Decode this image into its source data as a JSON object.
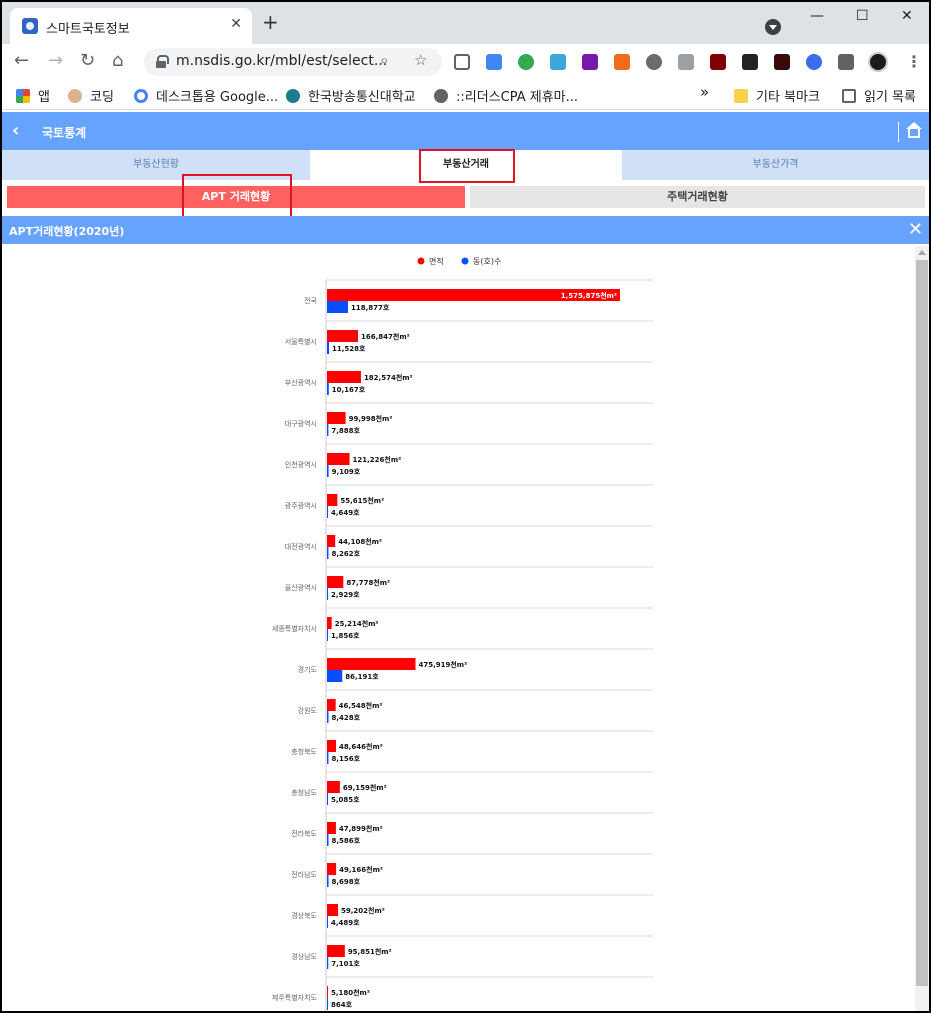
{
  "browser": {
    "tab_title": "스마트국토정보",
    "new_tab": "+",
    "url": "m.nsdis.go.kr/mbl/est/select...",
    "bookmarks": [
      {
        "label": "앱",
        "icon": "apps-grid-icon"
      },
      {
        "label": "코딩",
        "icon": "dog-icon"
      },
      {
        "label": "데스크톱용 Google...",
        "icon": "google-icon"
      },
      {
        "label": "한국방송통신대학교",
        "icon": "knou-icon"
      },
      {
        "label": "::리더스CPA 제휴마...",
        "icon": "globe-icon"
      }
    ],
    "more_bookmarks": "»",
    "other_bookmarks": "기타 북마크",
    "reading_list": "읽기 목록"
  },
  "app": {
    "title": "국토통계",
    "main_tabs": [
      "부동산현황",
      "부동산거래",
      "부동산가격"
    ],
    "active_main_tab": "부동산거래",
    "sub_tabs": [
      "APT 거래현황",
      "주택거래현황"
    ],
    "active_sub_tab": "APT 거래현황",
    "section_title": "APT거래현황(2020년)",
    "colors": {
      "header": "#66a3ff",
      "area": "#ff0000",
      "count": "#0a4fff",
      "active_sub": "#ff6161",
      "highlight": "#e2121e"
    }
  },
  "chart_data": {
    "type": "bar",
    "orientation": "horizontal",
    "legend_position": "top-center",
    "series": [
      {
        "name": "면적",
        "unit": "천m²",
        "color": "#ff0000",
        "values": [
          1575875,
          166847,
          182574,
          99998,
          121226,
          55615,
          44108,
          87778,
          25214,
          475919,
          46548,
          48646,
          69159,
          47899,
          49166,
          59202,
          95851,
          5180
        ]
      },
      {
        "name": "동(호)수",
        "unit": "호",
        "color": "#0a4fff",
        "values": [
          118877,
          11528,
          10167,
          7888,
          9109,
          4649,
          8262,
          2929,
          1856,
          86191,
          8428,
          8156,
          5085,
          8586,
          8698,
          4489,
          7101,
          864
        ]
      }
    ],
    "categories": [
      "전국",
      "서울특별시",
      "부산광역시",
      "대구광역시",
      "인천광역시",
      "광주광역시",
      "대전광역시",
      "울산광역시",
      "세종특별자치시",
      "경기도",
      "강원도",
      "충청북도",
      "충청남도",
      "전라북도",
      "전라남도",
      "경상북도",
      "경상남도",
      "제주특별자치도"
    ],
    "labels_area": [
      "1,575,875천m²",
      "166,847천m²",
      "182,574천m²",
      "99,998천m²",
      "121,226천m²",
      "55,615천m²",
      "44,108천m²",
      "87,778천m²",
      "25,214천m²",
      "475,919천m²",
      "46,548천m²",
      "48,646천m²",
      "69,159천m²",
      "47,899천m²",
      "49,166천m²",
      "59,202천m²",
      "95,851천m²",
      "5,180천m²"
    ],
    "labels_count": [
      "118,877호",
      "11,528호",
      "10,167호",
      "7,888호",
      "9,109호",
      "4,649호",
      "8,262호",
      "2,929호",
      "1,856호",
      "86,191호",
      "8,428호",
      "8,156호",
      "5,085호",
      "8,586호",
      "8,698호",
      "4,489호",
      "7,101호",
      "864호"
    ],
    "xlim": [
      0,
      1600000
    ]
  }
}
